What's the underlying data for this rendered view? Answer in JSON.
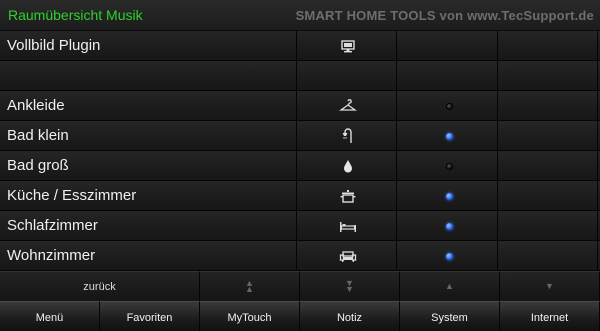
{
  "header": {
    "title": "Raumübersicht Musik",
    "brand": "SMART HOME TOOLS von www.TecSupport.de"
  },
  "rows": [
    {
      "label": "Vollbild Plugin",
      "icon": "monitor-icon",
      "state": null
    },
    {
      "label": "",
      "icon": null,
      "state": null
    },
    {
      "label": "Ankleide",
      "icon": "hanger-icon",
      "state": "off"
    },
    {
      "label": "Bad klein",
      "icon": "shower-icon",
      "state": "on"
    },
    {
      "label": "Bad groß",
      "icon": "water-drop-icon",
      "state": "off"
    },
    {
      "label": "Küche / Esszimmer",
      "icon": "cooking-pot-icon",
      "state": "on"
    },
    {
      "label": "Schlafzimmer",
      "icon": "bed-icon",
      "state": "on"
    },
    {
      "label": "Wohnzimmer",
      "icon": "sofa-icon",
      "state": "on"
    }
  ],
  "nav": {
    "back_label": "zurück",
    "buttons": [
      "page-up-icon",
      "page-down-icon",
      "scroll-up-icon",
      "scroll-down-icon"
    ]
  },
  "menu": [
    "Menü",
    "Favoriten",
    "MyTouch",
    "Notiz",
    "System",
    "Internet"
  ],
  "colors": {
    "title": "#2fd12f",
    "status_on": "#2a6bff",
    "status_off": "#111111"
  }
}
